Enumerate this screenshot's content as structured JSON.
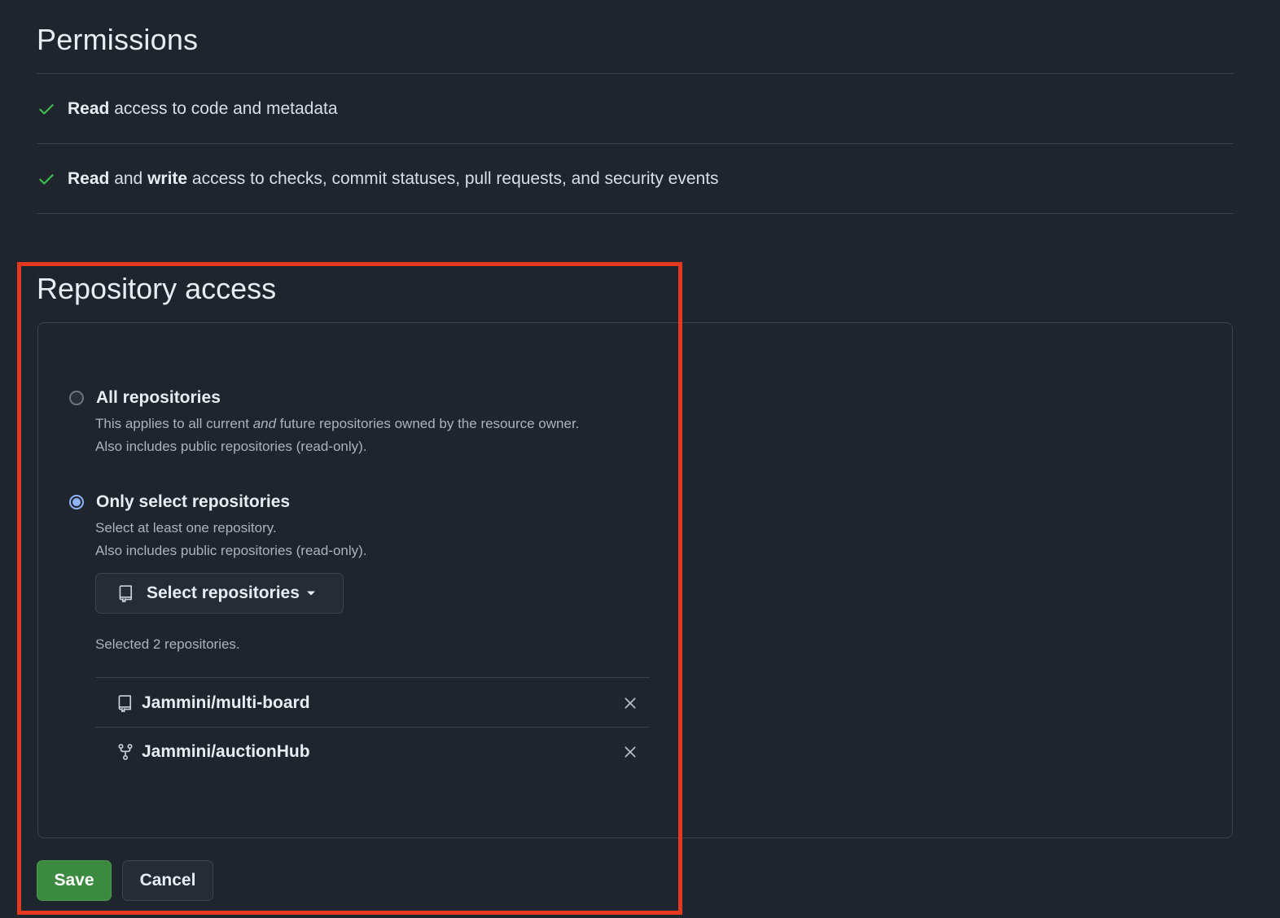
{
  "permissions": {
    "title": "Permissions",
    "items": [
      {
        "strong": "Read",
        "rest": " access to code and metadata"
      },
      {
        "strong1": "Read",
        "mid": " and ",
        "strong2": "write",
        "rest": " access to checks, commit statuses, pull requests, and security events"
      }
    ]
  },
  "repository_access": {
    "title": "Repository access",
    "options": [
      {
        "label": "All repositories",
        "desc_line1_pre": "This applies to all current ",
        "desc_line1_em": "and",
        "desc_line1_post": " future repositories owned by the resource owner.",
        "desc_line2": "Also includes public repositories (read-only).",
        "selected": false
      },
      {
        "label": "Only select repositories",
        "desc_line1": "Select at least one repository.",
        "desc_line2": "Also includes public repositories (read-only).",
        "selected": true
      }
    ],
    "select_button_label": "Select repositories",
    "selected_count_text": "Selected 2 repositories.",
    "repos": [
      {
        "name": "Jammini/multi-board",
        "icon": "repo-icon"
      },
      {
        "name": "Jammini/auctionHub",
        "icon": "repo-forked-icon"
      }
    ]
  },
  "actions": {
    "save_label": "Save",
    "cancel_label": "Cancel"
  },
  "colors": {
    "background": "#1f252d",
    "check": "#3fb950",
    "radio_accent": "#8fb3ff",
    "save_bg": "#3b8a3f",
    "highlight": "#e5391f"
  }
}
